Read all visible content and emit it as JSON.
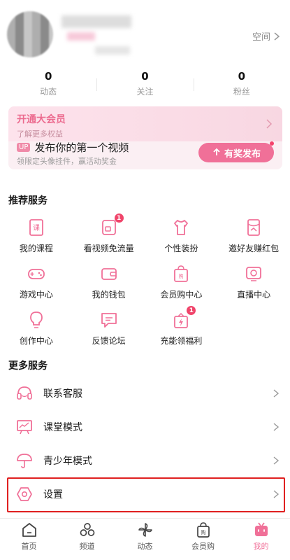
{
  "header": {
    "space_label": "空间"
  },
  "stats": [
    {
      "value": "0",
      "label": "动态"
    },
    {
      "value": "0",
      "label": "关注"
    },
    {
      "value": "0",
      "label": "粉丝"
    }
  ],
  "vip_banner": {
    "title": "开通大会员",
    "subtitle": "了解更多权益"
  },
  "publish": {
    "badge": "UP",
    "title": "发布你的第一个视频",
    "subtitle": "领限定头像挂件，赢活动奖金",
    "button": "有奖发布"
  },
  "recommended": {
    "title": "推荐服务",
    "items": [
      {
        "label": "我的课程",
        "icon": "course-icon"
      },
      {
        "label": "看视频免流量",
        "icon": "data-saver-icon",
        "badge": "1"
      },
      {
        "label": "个性装扮",
        "icon": "tshirt-icon"
      },
      {
        "label": "邀好友赚红包",
        "icon": "red-packet-icon"
      },
      {
        "label": "游戏中心",
        "icon": "gamepad-icon"
      },
      {
        "label": "我的钱包",
        "icon": "wallet-icon"
      },
      {
        "label": "会员购中心",
        "icon": "shopping-bag-icon"
      },
      {
        "label": "直播中心",
        "icon": "live-tv-icon"
      },
      {
        "label": "创作中心",
        "icon": "lightbulb-icon"
      },
      {
        "label": "反馈论坛",
        "icon": "chat-bubble-icon"
      },
      {
        "label": "充能领福利",
        "icon": "gift-icon",
        "badge": "1"
      }
    ]
  },
  "more_services": {
    "title": "更多服务",
    "items": [
      {
        "label": "联系客服",
        "icon": "headset-icon"
      },
      {
        "label": "课堂模式",
        "icon": "classroom-icon"
      },
      {
        "label": "青少年模式",
        "icon": "umbrella-icon"
      },
      {
        "label": "设置",
        "icon": "settings-hexagon-icon"
      }
    ]
  },
  "tabbar": [
    {
      "label": "首页",
      "icon": "home-icon"
    },
    {
      "label": "频道",
      "icon": "channel-icon"
    },
    {
      "label": "动态",
      "icon": "pinwheel-icon"
    },
    {
      "label": "会员购",
      "icon": "member-shop-icon"
    },
    {
      "label": "我的",
      "icon": "my-tv-icon",
      "active": true
    }
  ],
  "colors": {
    "accent": "#f07098",
    "badge": "#f0446a",
    "highlight": "#e02020"
  }
}
